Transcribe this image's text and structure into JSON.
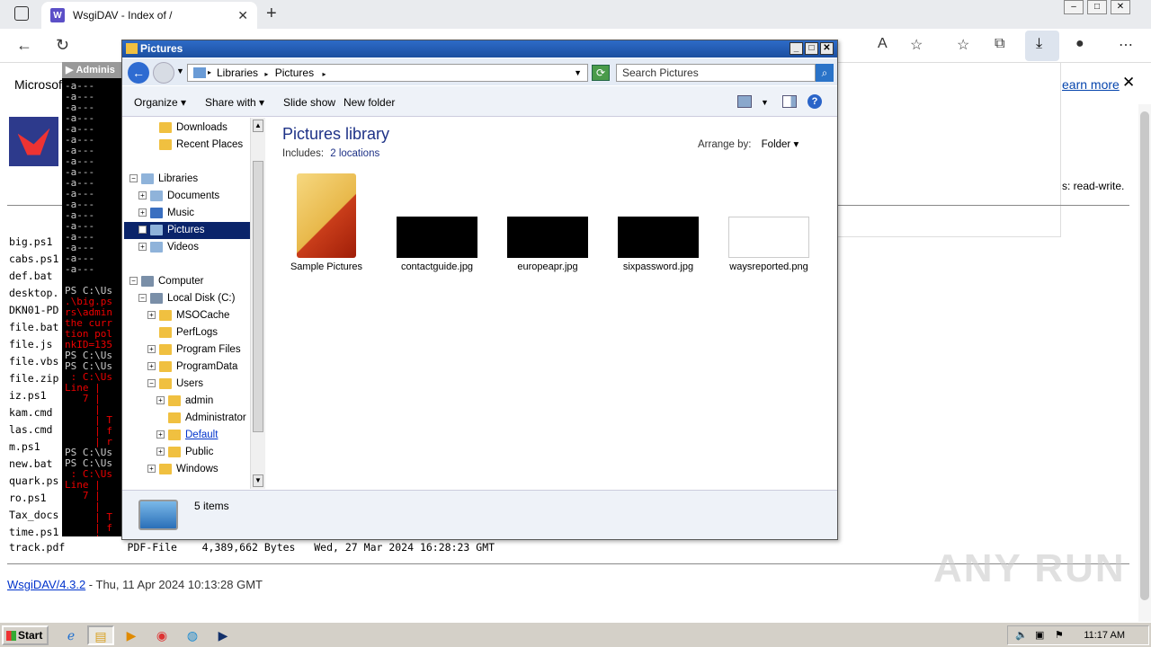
{
  "browser": {
    "tab_title": "WsgiDAV - Index of /",
    "tab_close": "✕",
    "new_tab": "+",
    "infobar_left": "Microsoft",
    "learn_more": "earn more",
    "read_write": "s: read-write."
  },
  "page": {
    "files": [
      "big.ps1",
      "cabs.ps1",
      "def.bat",
      "desktop.",
      "DKN01-PD",
      "file.bat",
      "file.js",
      "file.vbs",
      "file.zip",
      "iz.ps1",
      "kam.cmd",
      "las.cmd",
      "m.ps1",
      "new.bat",
      "quark.ps",
      "ro.ps1",
      "Tax_docs",
      "time.ps1"
    ],
    "track_row": "track.pdf          PDF-File    4,389,662 Bytes   Wed, 27 Mar 2024 16:28:23 GMT",
    "footer_link": "WsgiDAV/4.3.2",
    "footer_text": " - Thu, 11 Apr 2024 10:13:28 GMT",
    "watermark": "ANY RUN"
  },
  "console": {
    "title": "Adminis",
    "lines_white_top": [
      "-a---",
      "-a---",
      "-a---",
      "-a---",
      "-a---",
      "-a---",
      "-a---",
      "-a---",
      "-a---",
      "-a---",
      "-a---",
      "-a---",
      "-a---",
      "-a---",
      "-a---",
      "-a---",
      "-a---",
      "-a---",
      "",
      "PS C:\\Us"
    ],
    "lines_red_1": [
      ".\\big.ps",
      "rs\\admin",
      "the curr",
      "tion pol",
      "nkID=135"
    ],
    "lines_white_2": [
      "PS C:\\Us",
      "PS C:\\Us"
    ],
    "lines_red_2": [
      " : C:\\Us",
      "Line |",
      "   7 |",
      "     |",
      "     | T",
      "     | f",
      "     | r"
    ],
    "lines_white_3": [
      "PS C:\\Us",
      "PS C:\\Us"
    ],
    "lines_red_3": [
      " : C:\\Us",
      "Line |",
      "   7 |",
      "     |",
      "     | T",
      "     | f",
      "     | r"
    ],
    "lines_white_4": [
      "PS C:\\Us"
    ]
  },
  "explorer": {
    "title": "Pictures",
    "breadcrumb": [
      "Libraries",
      "Pictures"
    ],
    "search_placeholder": "Search Pictures",
    "toolbar": {
      "organize": "Organize",
      "share_with": "Share with",
      "slide_show": "Slide show",
      "new_folder": "New folder"
    },
    "nav": [
      {
        "label": "Downloads",
        "indent": 2,
        "exp": ""
      },
      {
        "label": "Recent Places",
        "indent": 2,
        "exp": ""
      },
      {
        "label": "Libraries",
        "indent": 0,
        "exp": "−"
      },
      {
        "label": "Documents",
        "indent": 1,
        "exp": "+"
      },
      {
        "label": "Music",
        "indent": 1,
        "exp": "+"
      },
      {
        "label": "Pictures",
        "indent": 1,
        "exp": "+"
      },
      {
        "label": "Videos",
        "indent": 1,
        "exp": "+"
      },
      {
        "label": "Computer",
        "indent": 0,
        "exp": "−"
      },
      {
        "label": "Local Disk (C:)",
        "indent": 1,
        "exp": "−"
      },
      {
        "label": "MSOCache",
        "indent": 2,
        "exp": "+"
      },
      {
        "label": "PerfLogs",
        "indent": 2,
        "exp": ""
      },
      {
        "label": "Program Files",
        "indent": 2,
        "exp": "+"
      },
      {
        "label": "ProgramData",
        "indent": 2,
        "exp": "+"
      },
      {
        "label": "Users",
        "indent": 2,
        "exp": "−"
      },
      {
        "label": "admin",
        "indent": 3,
        "exp": "+"
      },
      {
        "label": "Administrator",
        "indent": 3,
        "exp": ""
      },
      {
        "label": "Default",
        "indent": 3,
        "exp": "+"
      },
      {
        "label": "Public",
        "indent": 3,
        "exp": "+"
      },
      {
        "label": "Windows",
        "indent": 2,
        "exp": "+"
      }
    ],
    "library_title": "Pictures library",
    "includes_label": "Includes:",
    "includes_value": "2 locations",
    "arrange_label": "Arrange by:",
    "arrange_value": "Folder",
    "items": [
      {
        "name": "Sample Pictures",
        "kind": "folder"
      },
      {
        "name": "contactguide.jpg",
        "kind": "dark"
      },
      {
        "name": "europeapr.jpg",
        "kind": "dark"
      },
      {
        "name": "sixpassword.jpg",
        "kind": "dark"
      },
      {
        "name": "waysreported.png",
        "kind": "light"
      }
    ],
    "status": "5 items"
  },
  "taskbar": {
    "start": "Start",
    "clock": "11:17 AM"
  }
}
